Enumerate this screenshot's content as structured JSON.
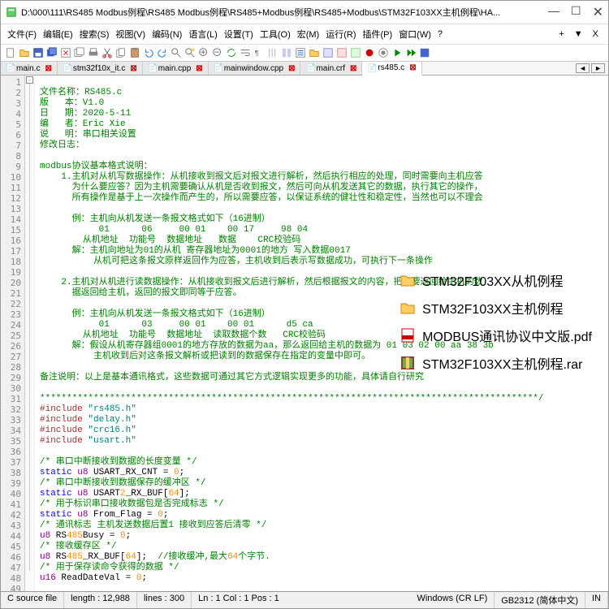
{
  "title": "D:\\000\\111\\RS485 Modbus例程\\RS485 Modbus例程\\RS485+Modbus例程\\RS485+Modbus\\STM32F103XX主机例程\\HA...",
  "winbtns": {
    "min": "—",
    "max": "☐",
    "close": "✕"
  },
  "menu": [
    "文件(F)",
    "编辑(E)",
    "搜索(S)",
    "视图(V)",
    "编码(N)",
    "语言(L)",
    "设置(T)",
    "工具(O)",
    "宏(M)",
    "运行(R)",
    "插件(P)",
    "窗口(W)",
    "?"
  ],
  "menu_right": [
    "+",
    "▼",
    "X"
  ],
  "tabs": [
    {
      "label": "main.c",
      "active": false
    },
    {
      "label": "stm32f10x_it.c",
      "active": false
    },
    {
      "label": "main.cpp",
      "active": false
    },
    {
      "label": "mainwindow.cpp",
      "active": false
    },
    {
      "label": "main.crf",
      "active": false
    },
    {
      "label": "rs485.c",
      "active": true
    }
  ],
  "overlay": [
    {
      "icon": "folder",
      "label": "STM32F103XX从机例程"
    },
    {
      "icon": "folder",
      "label": "STM32F103XX主机例程"
    },
    {
      "icon": "pdf",
      "label": "MODBUS通讯协议中文版.pdf"
    },
    {
      "icon": "rar",
      "label": "STM32F103XX主机例程.rar"
    }
  ],
  "lines": [
    {
      "n": 1,
      "t": "",
      "cls": ""
    },
    {
      "n": 2,
      "t": "文件名称：RS485.c",
      "cls": "c-comment"
    },
    {
      "n": 3,
      "t": "版   本：V1.0",
      "cls": "c-comment"
    },
    {
      "n": 4,
      "t": "日   期：2020-5-11",
      "cls": "c-comment"
    },
    {
      "n": 5,
      "t": "编   者：Eric Xie",
      "cls": "c-comment"
    },
    {
      "n": 6,
      "t": "说   明：串口相关设置",
      "cls": "c-comment"
    },
    {
      "n": 7,
      "t": "修改日志：",
      "cls": "c-comment"
    },
    {
      "n": 8,
      "t": "",
      "cls": ""
    },
    {
      "n": 9,
      "t": "modbus协议基本格式说明：",
      "cls": "c-comment"
    },
    {
      "n": 10,
      "t": "    1.主机对从机写数据操作：从机接收到报文后对报文进行解析，然后执行相应的处理，同时需要向主机应答",
      "cls": "c-comment"
    },
    {
      "n": 11,
      "t": "      为什么要应答？因为主机需要确认从机是否收到报文，然后可向从机发送其它的数据，执行其它的操作，",
      "cls": "c-comment"
    },
    {
      "n": 12,
      "t": "      所有操作是基于上一次操作而产生的，所以需要应答，以保证系统的健壮性和稳定性，当然也可以不理会",
      "cls": "c-comment"
    },
    {
      "n": 13,
      "t": "",
      "cls": ""
    },
    {
      "n": 14,
      "t": "      例：主机向从机发送一条报文格式如下（16进制）",
      "cls": "c-comment"
    },
    {
      "n": 15,
      "t": "           01      06     00 01    00 17     98 04",
      "cls": "c-comment"
    },
    {
      "n": 16,
      "t": "        从机地址  功能号  数据地址   数据    CRC校验码",
      "cls": "c-comment"
    },
    {
      "n": 17,
      "t": "      解：主机向地址为01的从机 寄存器地址为0001的地方 写入数据0017",
      "cls": "c-comment"
    },
    {
      "n": 18,
      "t": "          从机可把这条报文原样返回作为应答，主机收到后表示写数据成功，可执行下一条操作",
      "cls": "c-comment"
    },
    {
      "n": 19,
      "t": "",
      "cls": ""
    },
    {
      "n": 20,
      "t": "    2.主机对从机进行读数据操作：从机接收到报文后进行解析，然后根据报文的内容，把需要返回给主机的数",
      "cls": "c-comment"
    },
    {
      "n": 21,
      "t": "      据返回给主机，返回的报文即同等于应答。",
      "cls": "c-comment"
    },
    {
      "n": 22,
      "t": "",
      "cls": ""
    },
    {
      "n": 23,
      "t": "      例：主机向从机发送一条报文格式如下（16进制）",
      "cls": "c-comment"
    },
    {
      "n": 24,
      "t": "           01      03     00 01    00 01      d5 ca",
      "cls": "c-comment"
    },
    {
      "n": 25,
      "t": "        从机地址  功能号  数据地址  读取数据个数   CRC校验码",
      "cls": "c-comment"
    },
    {
      "n": 26,
      "t": "      解：假设从机寄存器组0001的地方存放的数据为aa，那么返回给主机的数据为 01 03 02 00 aa 38 3b",
      "cls": "c-comment"
    },
    {
      "n": 27,
      "t": "          主机收到后对这条报文解析或把读到的数据保存在指定的变量中即可。",
      "cls": "c-comment"
    },
    {
      "n": 28,
      "t": "",
      "cls": ""
    },
    {
      "n": 29,
      "t": "备注说明：以上是基本通讯格式，这些数据可通过其它方式逻辑实现更多的功能，具体请自行研究",
      "cls": "c-comment"
    },
    {
      "n": 30,
      "t": "",
      "cls": ""
    },
    {
      "n": 31,
      "t": "*********************************************************************************************/",
      "cls": "c-comment"
    },
    {
      "n": 32,
      "t": "#include \"rs485.h\"",
      "cls": "c-preproc"
    },
    {
      "n": 33,
      "t": "#include \"delay.h\"",
      "cls": "c-preproc"
    },
    {
      "n": 34,
      "t": "#include \"crc16.h\"",
      "cls": "c-preproc"
    },
    {
      "n": 35,
      "t": "#include \"usart.h\"",
      "cls": "c-preproc"
    },
    {
      "n": 36,
      "t": "",
      "cls": ""
    },
    {
      "n": 37,
      "t": "/* 串口中断接收到数据的长度变量 */",
      "cls": "c-comment"
    },
    {
      "n": 38,
      "t": "static u8 USART_RX_CNT = 0;",
      "cls": ""
    },
    {
      "n": 39,
      "t": "/* 串口中断接收到数据保存的缓冲区 */",
      "cls": "c-comment"
    },
    {
      "n": 40,
      "t": "static u8 USART2_RX_BUF[64];",
      "cls": ""
    },
    {
      "n": 41,
      "t": "/* 用于标识串口接收数据包是否完成标志 */",
      "cls": "c-comment"
    },
    {
      "n": 42,
      "t": "static u8 From_Flag = 0;",
      "cls": ""
    },
    {
      "n": 43,
      "t": "/* 通讯标志 主机发送数据后置1 接收到应答后清零 */",
      "cls": "c-comment"
    },
    {
      "n": 44,
      "t": "u8 RS485Busy = 0;",
      "cls": ""
    },
    {
      "n": 45,
      "t": "/* 接收缓存区 */",
      "cls": "c-comment"
    },
    {
      "n": 46,
      "t": "u8 RS485_RX_BUF[64];  //接收缓冲,最大64个字节.",
      "cls": ""
    },
    {
      "n": 47,
      "t": "/* 用于保存读命令获得的数据 */",
      "cls": "c-comment"
    },
    {
      "n": 48,
      "t": "u16 ReadDateVal = 0;",
      "cls": ""
    },
    {
      "n": 49,
      "t": "",
      "cls": ""
    }
  ],
  "status": {
    "type": "C source file",
    "length": "length : 12,988",
    "lines": "lines : 300",
    "pos": "Ln : 1    Col : 1    Pos : 1",
    "eol": "Windows (CR LF)",
    "enc": "GB2312 (简体中文)",
    "ins": "IN"
  }
}
